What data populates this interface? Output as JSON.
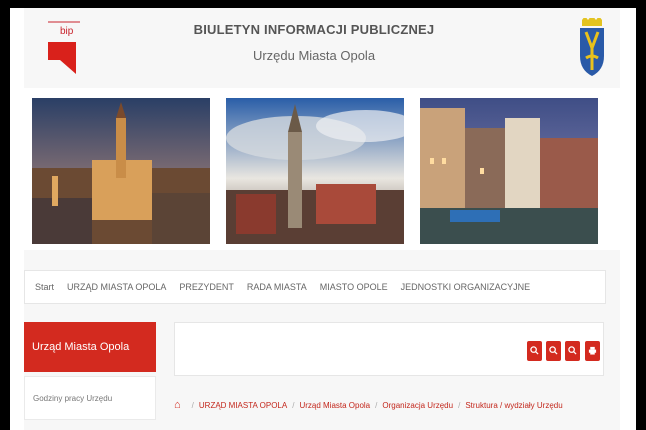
{
  "header": {
    "logo_text": "bip",
    "title_line1": "BIULETYN INFORMACJI PUBLICZNEJ",
    "title_line2": "Urzędu Miasta Opola"
  },
  "nav": {
    "items": [
      "Start",
      "URZĄD MIASTA OPOLA",
      "PREZYDENT",
      "RADA MIASTA",
      "MIASTO OPOLE",
      "JEDNOSTKI ORGANIZACYJNE"
    ]
  },
  "sidebar": {
    "active_label": "Urząd Miasta Opola",
    "items": [
      "Godziny pracy Urzędu"
    ]
  },
  "tools": {
    "buttons": [
      "zoom-in-icon",
      "zoom-reset-icon",
      "zoom-out-icon",
      "print-icon"
    ]
  },
  "breadcrumb": {
    "items": [
      "URZĄD MIASTA OPOLA",
      "Urząd Miasta Opola",
      "Organizacja Urzędu",
      "Struktura / wydziały Urzędu"
    ]
  },
  "colors": {
    "accent": "#d32a1f"
  }
}
